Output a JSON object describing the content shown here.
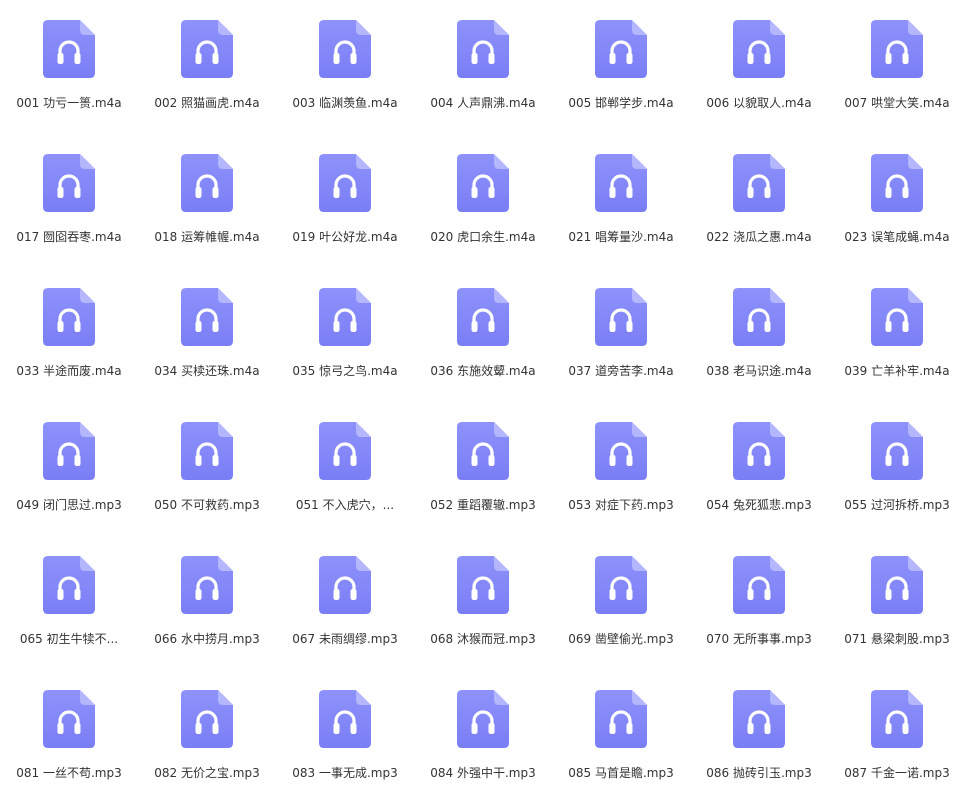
{
  "accent_color": "#8286f8",
  "icon": "audio-file-headphones-icon",
  "files": [
    {
      "name": "001 功亏一篑.m4a"
    },
    {
      "name": "002 照猫画虎.m4a"
    },
    {
      "name": "003 临渊羡鱼.m4a"
    },
    {
      "name": "004 人声鼎沸.m4a"
    },
    {
      "name": "005 邯郸学步.m4a"
    },
    {
      "name": "006 以貌取人.m4a"
    },
    {
      "name": "007 哄堂大笑.m4a"
    },
    {
      "name": "017 囫囵吞枣.m4a"
    },
    {
      "name": "018 运筹帷幄.m4a"
    },
    {
      "name": "019 叶公好龙.m4a"
    },
    {
      "name": "020 虎口余生.m4a"
    },
    {
      "name": "021 唱筹量沙.m4a"
    },
    {
      "name": "022 浇瓜之惠.m4a"
    },
    {
      "name": "023 误笔成蝇.m4a"
    },
    {
      "name": "033 半途而废.m4a"
    },
    {
      "name": "034 买椟还珠.m4a"
    },
    {
      "name": "035 惊弓之鸟.m4a"
    },
    {
      "name": "036 东施效颦.m4a"
    },
    {
      "name": "037 道旁苦李.m4a"
    },
    {
      "name": "038 老马识途.m4a"
    },
    {
      "name": "039 亡羊补牢.m4a"
    },
    {
      "name": "049 闭门思过.mp3"
    },
    {
      "name": "050 不可救药.mp3"
    },
    {
      "name": "051 不入虎穴，..."
    },
    {
      "name": "052 重蹈覆辙.mp3"
    },
    {
      "name": "053 对症下药.mp3"
    },
    {
      "name": "054 兔死狐悲.mp3"
    },
    {
      "name": "055 过河拆桥.mp3"
    },
    {
      "name": "065 初生牛犊不..."
    },
    {
      "name": "066 水中捞月.mp3"
    },
    {
      "name": "067 未雨绸缪.mp3"
    },
    {
      "name": "068 沐猴而冠.mp3"
    },
    {
      "name": "069 凿壁偷光.mp3"
    },
    {
      "name": "070 无所事事.mp3"
    },
    {
      "name": "071 悬梁刺股.mp3"
    },
    {
      "name": "081 一丝不苟.mp3"
    },
    {
      "name": "082 无价之宝.mp3"
    },
    {
      "name": "083 一事无成.mp3"
    },
    {
      "name": "084 外强中干.mp3"
    },
    {
      "name": "085 马首是瞻.mp3"
    },
    {
      "name": "086 抛砖引玉.mp3"
    },
    {
      "name": "087 千金一诺.mp3"
    }
  ]
}
